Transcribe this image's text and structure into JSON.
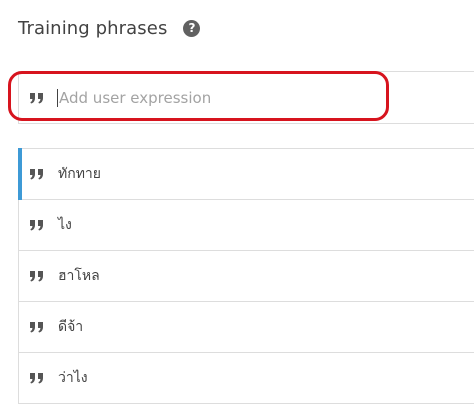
{
  "section": {
    "title": "Training phrases",
    "help_icon": "question-circle-icon"
  },
  "input": {
    "placeholder": "Add user expression",
    "value": "",
    "icon": "quote-icon"
  },
  "highlight": {
    "color": "#d7141e"
  },
  "accent_color": "#3e9ad6",
  "phrases": [
    {
      "text": "ทักทาย",
      "icon": "quote-icon",
      "active": true
    },
    {
      "text": "ไง",
      "icon": "quote-icon",
      "active": false
    },
    {
      "text": "ฮาโหล",
      "icon": "quote-icon",
      "active": false
    },
    {
      "text": "ดีจ้า",
      "icon": "quote-icon",
      "active": false
    },
    {
      "text": "ว่าไง",
      "icon": "quote-icon",
      "active": false
    }
  ]
}
